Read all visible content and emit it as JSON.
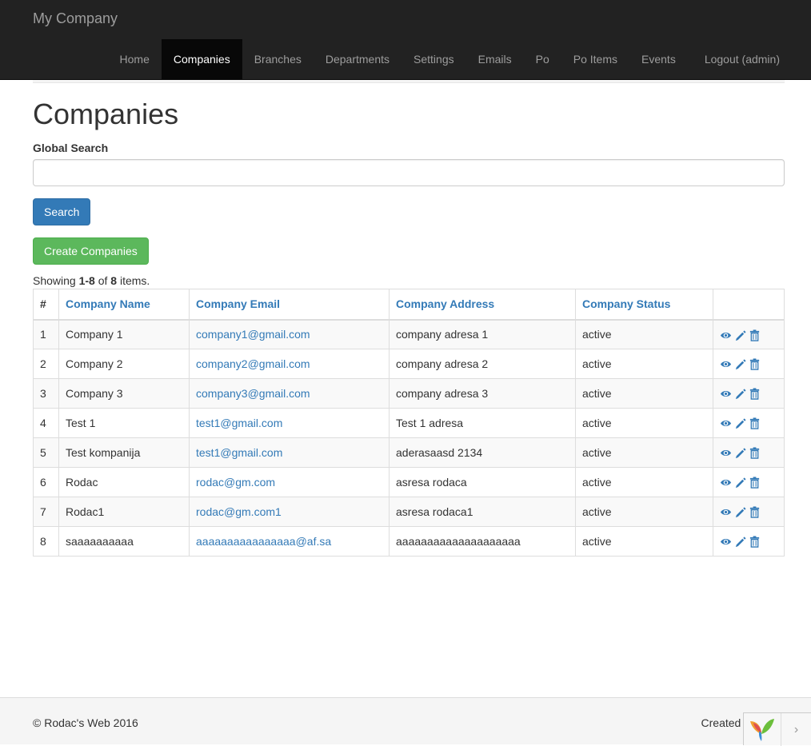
{
  "brand": "My Company",
  "nav": [
    {
      "label": "Home",
      "active": false
    },
    {
      "label": "Companies",
      "active": true
    },
    {
      "label": "Branches",
      "active": false
    },
    {
      "label": "Departments",
      "active": false
    },
    {
      "label": "Settings",
      "active": false
    },
    {
      "label": "Emails",
      "active": false
    },
    {
      "label": "Po",
      "active": false
    },
    {
      "label": "Po Items",
      "active": false
    },
    {
      "label": "Events",
      "active": false
    },
    {
      "label": "Logout (admin)",
      "active": false
    }
  ],
  "page_title": "Companies",
  "search": {
    "label": "Global Search",
    "value": "",
    "placeholder": "",
    "button": "Search"
  },
  "create_button": "Create Companies",
  "summary": {
    "prefix": "Showing ",
    "range": "1-8",
    "middle": " of ",
    "total": "8",
    "suffix": " items."
  },
  "table": {
    "headers": [
      "#",
      "Company Name",
      "Company Email",
      "Company Address",
      "Company Status"
    ],
    "rows": [
      [
        "1",
        "Company 1",
        "company1@gmail.com",
        "company adresa 1",
        "active"
      ],
      [
        "2",
        "Company 2",
        "company2@gmail.com",
        "company adresa 2",
        "active"
      ],
      [
        "3",
        "Company 3",
        "company3@gmail.com",
        "company adresa 3",
        "active"
      ],
      [
        "4",
        "Test 1",
        "test1@gmail.com",
        "Test 1 adresa",
        "active"
      ],
      [
        "5",
        "Test kompanija",
        "test1@gmail.com",
        "aderasaasd 2134",
        "active"
      ],
      [
        "6",
        "Rodac",
        "rodac@gm.com",
        "asresa rodaca",
        "active"
      ],
      [
        "7",
        "Rodac1",
        "rodac@gm.com1",
        "asresa rodaca1",
        "active"
      ],
      [
        "8",
        "saaaaaaaaaa",
        "aaaaaaaaaaaaaaaa@af.sa",
        "aaaaaaaaaaaaaaaaaaaa",
        "active"
      ]
    ],
    "action_icons": [
      "eye-icon",
      "pencil-icon",
      "trash-icon"
    ]
  },
  "footer": {
    "copyright": "© Rodac's Web 2016",
    "created": "Created b"
  },
  "colors": {
    "navbar": "#222222",
    "link": "#337ab7",
    "primary": "#337ab7",
    "success": "#5cb85c"
  }
}
